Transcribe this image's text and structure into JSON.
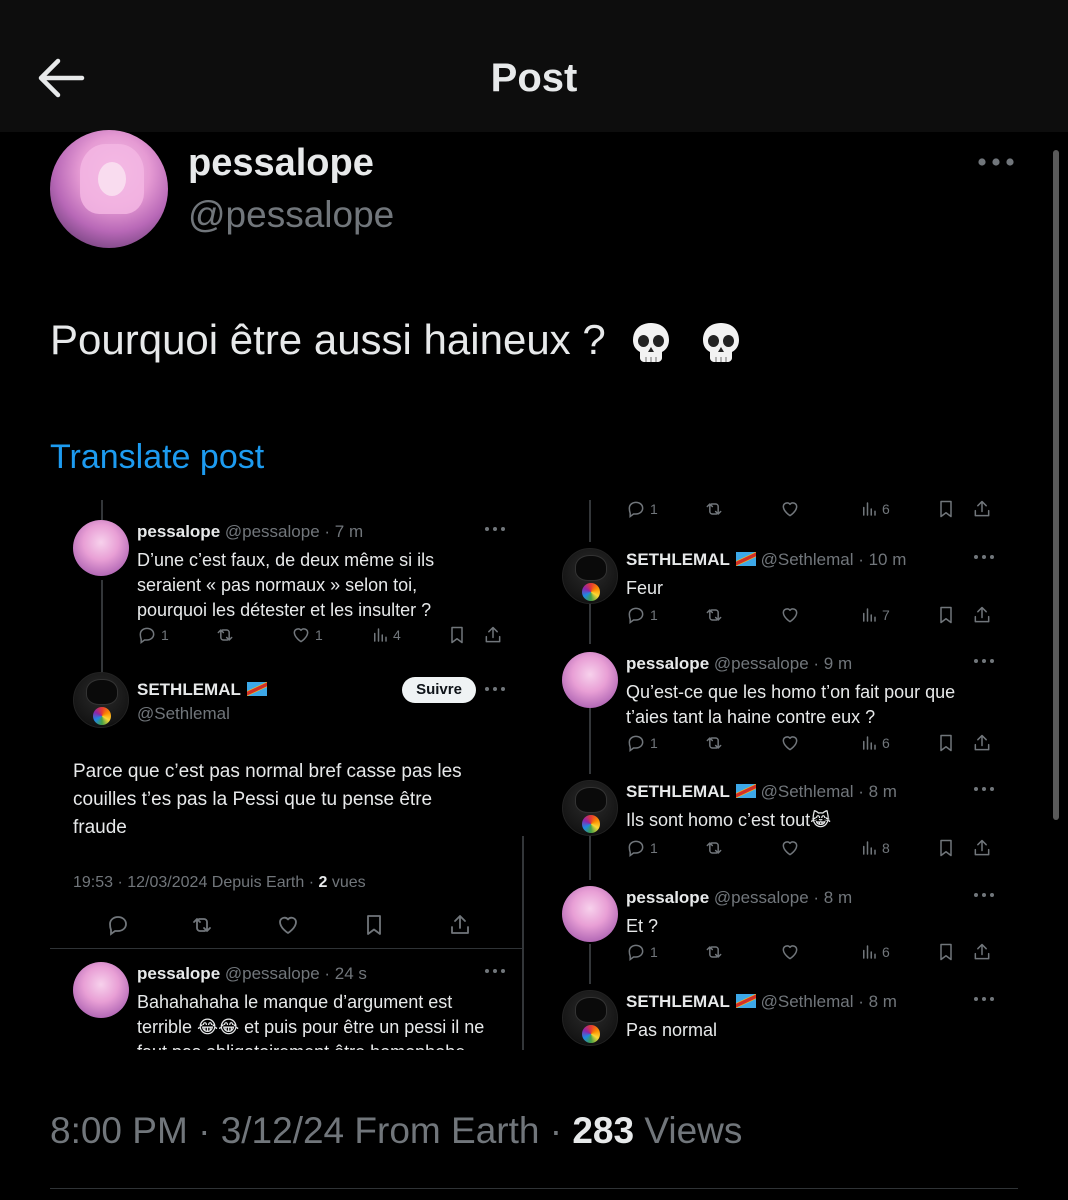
{
  "header": {
    "title": "Post"
  },
  "post": {
    "author_name": "pessalope",
    "author_handle": "@pessalope",
    "text": "Pourquoi être aussi haineux ?",
    "emojis": [
      "skull",
      "skull"
    ],
    "translate": "Translate post",
    "footer": {
      "time": "8:00 PM",
      "date": "3/12/24",
      "source": "From Earth",
      "views": "283",
      "views_label": "Views"
    }
  },
  "embed": {
    "left": {
      "tweet1": {
        "name": "pessalope",
        "handle": "@pessalope",
        "time": "7 m",
        "lines": [
          "D’une c’est faux, de deux même si ils",
          "seraient « pas normaux » selon toi,",
          "pourquoi les détester et les insulter ?"
        ],
        "replies": "1",
        "likes": "1",
        "views": "4"
      },
      "detail": {
        "name": "SETHLEMAL",
        "handle": "@Sethlemal",
        "follow": "Suivre",
        "lines": [
          "Parce que c’est pas normal bref casse pas les",
          "couilles t’es pas la Pessi que tu pense être",
          "fraude"
        ],
        "meta": "19:53 · 12/03/2024 Depuis Earth · ",
        "views": "2",
        "views_label": " vues"
      },
      "tweet2": {
        "name": "pessalope",
        "handle": "@pessalope",
        "time": "24 s",
        "line1": "Bahahahaha le manque d’argument est",
        "line2a": "terrible",
        "line2b": "et puis pour être un pessi il ne",
        "line3": "faut pas obligatoirement être homophobe"
      }
    },
    "right": {
      "top": {
        "replies": "1",
        "views": "6"
      },
      "t1": {
        "name": "SETHLEMAL",
        "handle": "@Sethlemal",
        "time": "10 m",
        "lines": [
          "Feur"
        ],
        "replies": "1",
        "views": "7"
      },
      "t2": {
        "name": "pessalope",
        "handle": "@pessalope",
        "time": "9 m",
        "lines": [
          "Qu’est-ce que les homo t’on fait pour que",
          "t’aies tant la haine contre eux ?"
        ],
        "replies": "1",
        "views": "6"
      },
      "t3": {
        "name": "SETHLEMAL",
        "handle": "@Sethlemal",
        "time": "8 m",
        "lines": [
          "Ils sont homo c’est tout"
        ],
        "replies": "1",
        "views": "8"
      },
      "t4": {
        "name": "pessalope",
        "handle": "@pessalope",
        "time": "8 m",
        "lines": [
          "Et ?"
        ],
        "replies": "1",
        "views": "6"
      },
      "t5": {
        "name": "SETHLEMAL",
        "handle": "@Sethlemal",
        "time": "8 m",
        "lines": [
          "Pas normal"
        ]
      }
    }
  },
  "colors": {
    "background": "#000000",
    "text": "#e7e9ea",
    "muted": "#71767b",
    "link": "#1d9bf0",
    "divider": "#2f3336"
  }
}
